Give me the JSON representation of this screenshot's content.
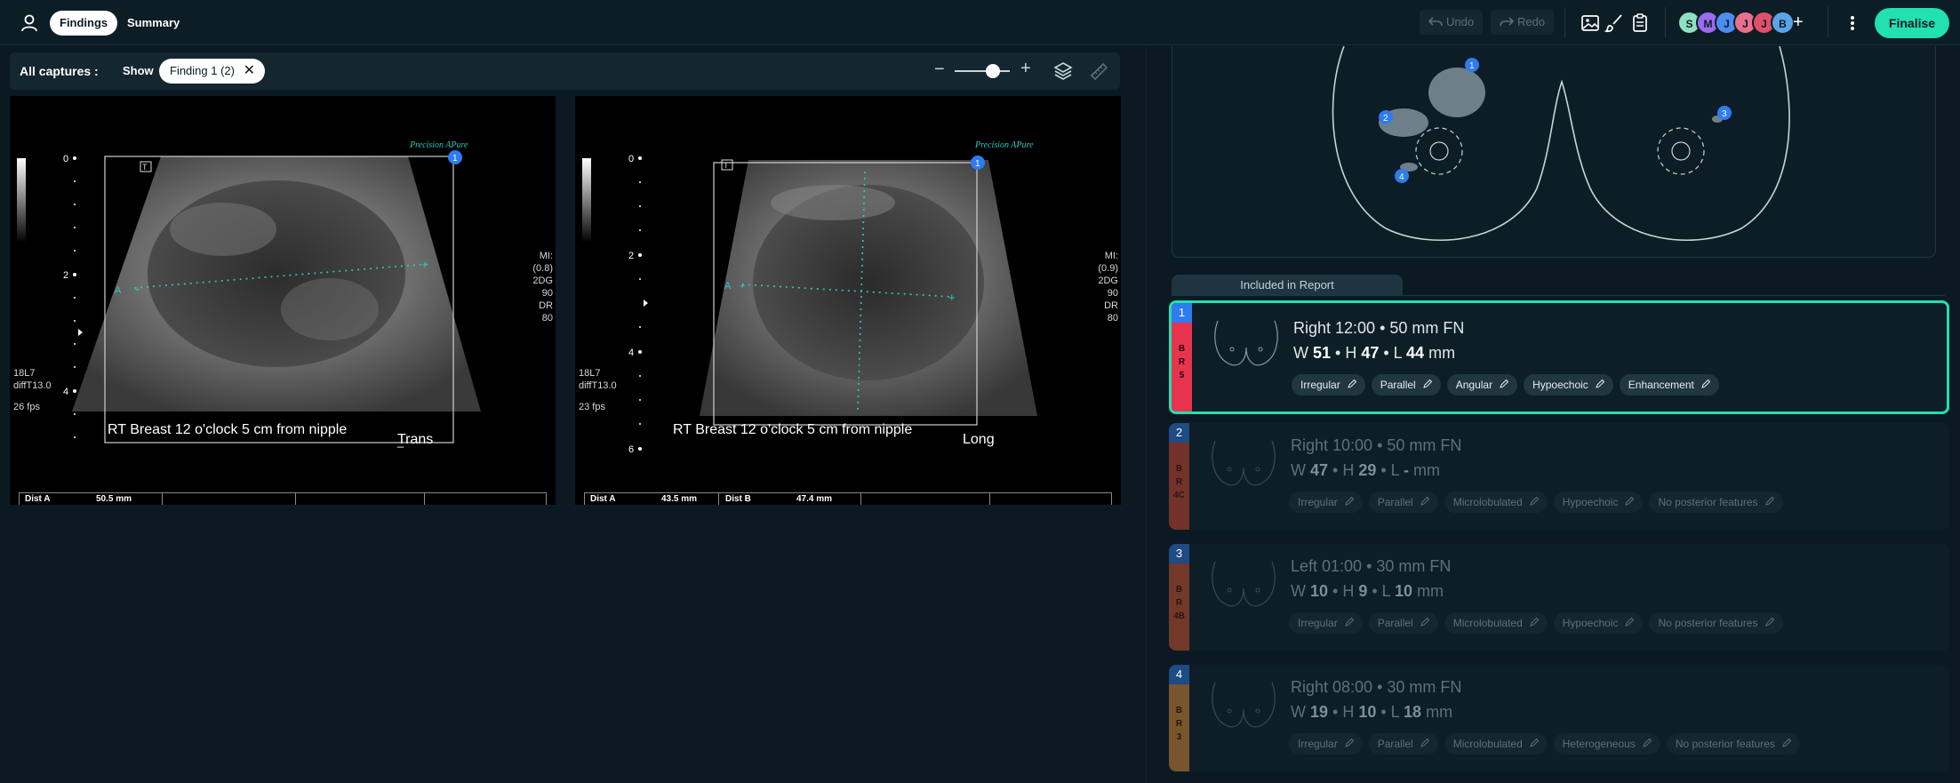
{
  "topbar": {
    "tabs": [
      {
        "label": "Findings",
        "active": true
      },
      {
        "label": "Summary",
        "active": false
      }
    ],
    "undo_label": "Undo",
    "redo_label": "Redo",
    "avatars": [
      {
        "initial": "S",
        "color": "#8fe0c0"
      },
      {
        "initial": "M",
        "color": "#9a6cf0"
      },
      {
        "initial": "J",
        "color": "#4d8df2"
      },
      {
        "initial": "J",
        "color": "#e8708a"
      },
      {
        "initial": "J",
        "color": "#e0506a"
      },
      {
        "initial": "B",
        "color": "#5aa4e6"
      }
    ],
    "add_avatar_glyph": "+",
    "finalise_label": "Finalise"
  },
  "captures": {
    "title": "All captures :",
    "show_label": "Show",
    "filter_chip": "Finding 1 (2)",
    "chip_close_glyph": "✕",
    "zoom_minus_glyph": "−",
    "zoom_plus_glyph": "+",
    "zoom_level": 0.7
  },
  "images": [
    {
      "caption": "RT Breast 12 o'clock 5 cm from nipple",
      "view": "Trans",
      "brand": "Precision APure",
      "left_info": [
        "18L7",
        "diffT13.0",
        "",
        "26 fps"
      ],
      "right_info": [
        "MI:(0.8)",
        "2DG",
        "90",
        "DR",
        "80"
      ],
      "depth_marks": [
        "0",
        "2",
        "4"
      ],
      "marker_badge": "1",
      "measure_letter": "A",
      "measurements": [
        {
          "label": "Dist  A",
          "value": "50.5  mm"
        }
      ]
    },
    {
      "caption": "RT Breast 12 o'clock 5 cm from nipple",
      "view": "Long",
      "brand": "Precision APure",
      "left_info": [
        "18L7",
        "diffT13.0",
        "",
        "23 fps"
      ],
      "right_info": [
        "MI:(0.9)",
        "2DG",
        "90",
        "DR",
        "80"
      ],
      "depth_marks": [
        "0",
        "2",
        "4",
        "6"
      ],
      "marker_badge": "1",
      "measure_letter": "A",
      "measurements": [
        {
          "label": "Dist  A",
          "value": "43.5  mm"
        },
        {
          "label": "Dist  B",
          "value": "47.4  mm"
        }
      ]
    }
  ],
  "diagram": {
    "markers": [
      "1",
      "2",
      "3",
      "4"
    ]
  },
  "report_tab": "Included in Report",
  "findings": [
    {
      "number": "1",
      "birads": [
        "B",
        "R",
        "5"
      ],
      "color": "#e8334e",
      "number_bg": "#2f7bf0",
      "title": "Right 12:00 • 50 mm FN",
      "w": "51",
      "h": "47",
      "l": "44",
      "unit": "mm",
      "tags": [
        "Irregular",
        "Parallel",
        "Angular",
        "Hypoechoic",
        "Enhancement"
      ],
      "selected": true
    },
    {
      "number": "2",
      "birads": [
        "B",
        "R",
        "4C"
      ],
      "color": "#b8402c",
      "number_bg": "#1e4a86",
      "title": "Right 10:00 • 50 mm FN",
      "w": "47",
      "h": "29",
      "l": "-",
      "unit": "mm",
      "tags": [
        "Irregular",
        "Parallel",
        "Microlobulated",
        "Hypoechoic",
        "No posterior features"
      ],
      "selected": false
    },
    {
      "number": "3",
      "birads": [
        "B",
        "R",
        "4B"
      ],
      "color": "#b84a2c",
      "number_bg": "#1e4a86",
      "title": "Left 01:00 • 30 mm FN",
      "w": "10",
      "h": "9",
      "l": "10",
      "unit": "mm",
      "tags": [
        "Irregular",
        "Parallel",
        "Microlobulated",
        "Hypoechoic",
        "No posterior features"
      ],
      "selected": false
    },
    {
      "number": "4",
      "birads": [
        "B",
        "R",
        "3"
      ],
      "color": "#c07a30",
      "number_bg": "#1e4a86",
      "title": "Right 08:00 • 30 mm FN",
      "w": "19",
      "h": "10",
      "l": "18",
      "unit": "mm",
      "tags": [
        "Irregular",
        "Parallel",
        "Microlobulated",
        "Heterogeneous",
        "No posterior features"
      ],
      "selected": false
    }
  ]
}
